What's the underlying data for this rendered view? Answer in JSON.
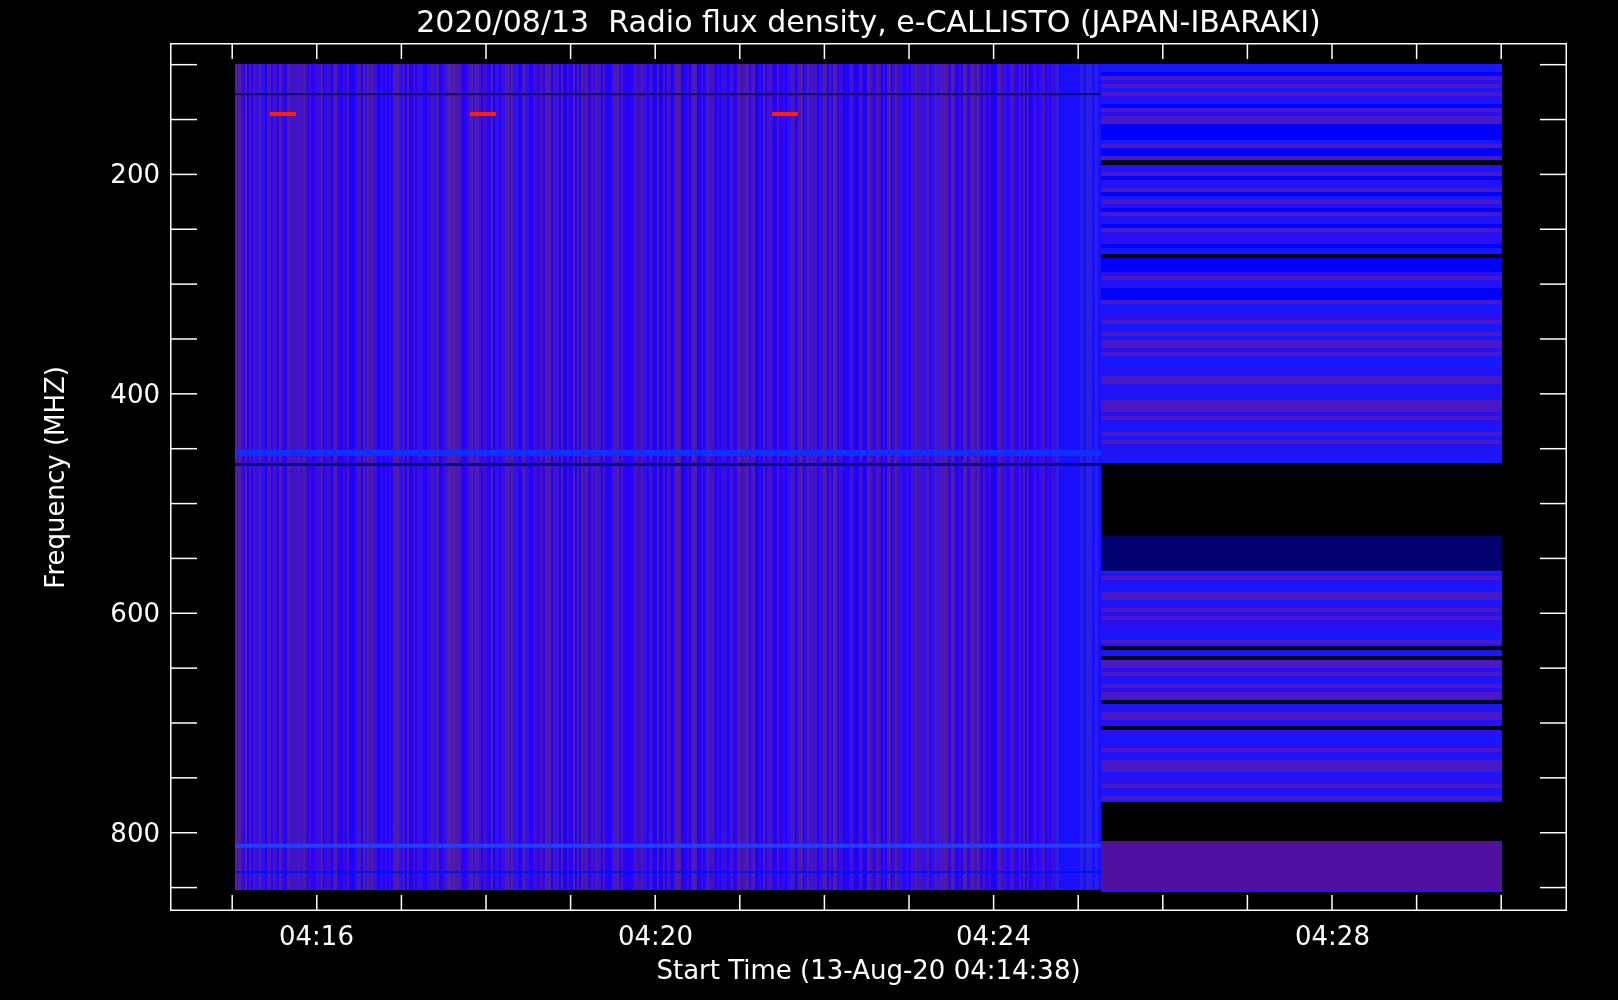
{
  "chart": {
    "title": "2020/08/13  Radio flux density, e-CALLISTO (JAPAN-IBARAKI)",
    "xlabel": "Start Time (13-Aug-20 04:14:38)",
    "ylabel": "Frequency (MHZ)",
    "yticks": [
      {
        "label": "200"
      },
      {
        "label": "400"
      },
      {
        "label": "600"
      },
      {
        "label": "800"
      }
    ],
    "xticks": [
      {
        "label": "04:16"
      },
      {
        "label": "04:20"
      },
      {
        "label": "04:24"
      },
      {
        "label": "04:28"
      }
    ]
  }
}
